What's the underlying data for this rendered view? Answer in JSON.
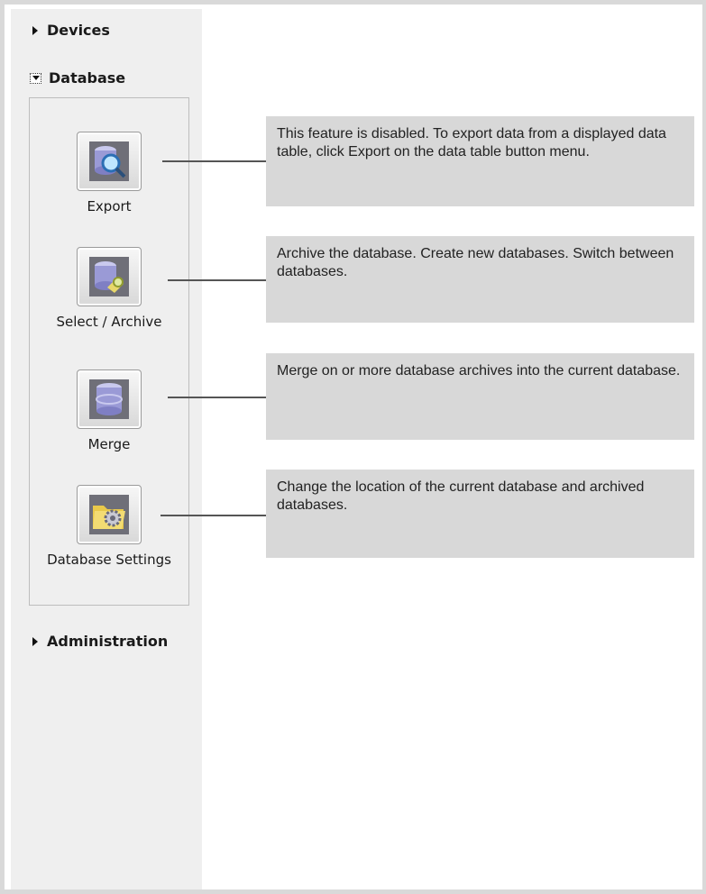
{
  "sidebar": {
    "devices_label": "Devices",
    "database_label": "Database",
    "administration_label": "Administration"
  },
  "tools": {
    "export": {
      "label": "Export",
      "description": "This feature is disabled. To export data from a displayed data table, click Export on the data table button menu."
    },
    "select_archive": {
      "label": "Select / Archive",
      "description": "Archive the database. Create new databases. Switch between databases."
    },
    "merge": {
      "label": "Merge",
      "description": "Merge on or more database archives into the current database."
    },
    "database_settings": {
      "label": "Database Settings",
      "description": "Change the location of the current database and archived databases."
    }
  }
}
